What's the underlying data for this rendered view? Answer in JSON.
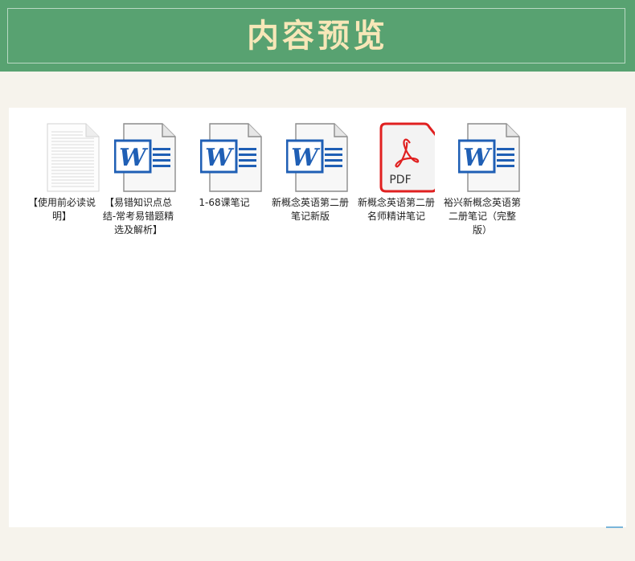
{
  "header": {
    "title": "内容预览"
  },
  "files": [
    {
      "name": "【使用前必读说明】",
      "type": "txt",
      "icon": "text-document-icon"
    },
    {
      "name": "【易错知识点总结-常考易错题精选及解析】",
      "type": "word",
      "icon": "word-document-icon"
    },
    {
      "name": "1-68课笔记",
      "type": "word",
      "icon": "word-document-icon"
    },
    {
      "name": "新概念英语第二册笔记新版",
      "type": "word",
      "icon": "word-document-icon"
    },
    {
      "name": "新概念英语第二册名师精讲笔记",
      "type": "pdf",
      "icon": "pdf-document-icon",
      "icon_label": "PDF"
    },
    {
      "name": "裕兴新概念英语第二册笔记（完整版）",
      "type": "word",
      "icon": "word-document-icon"
    }
  ],
  "colors": {
    "header_bg": "#58a271",
    "title": "#f7e7b8",
    "page_bg": "#f6f3ec",
    "word_blue": "#1f5fb5",
    "pdf_red": "#e02020"
  }
}
